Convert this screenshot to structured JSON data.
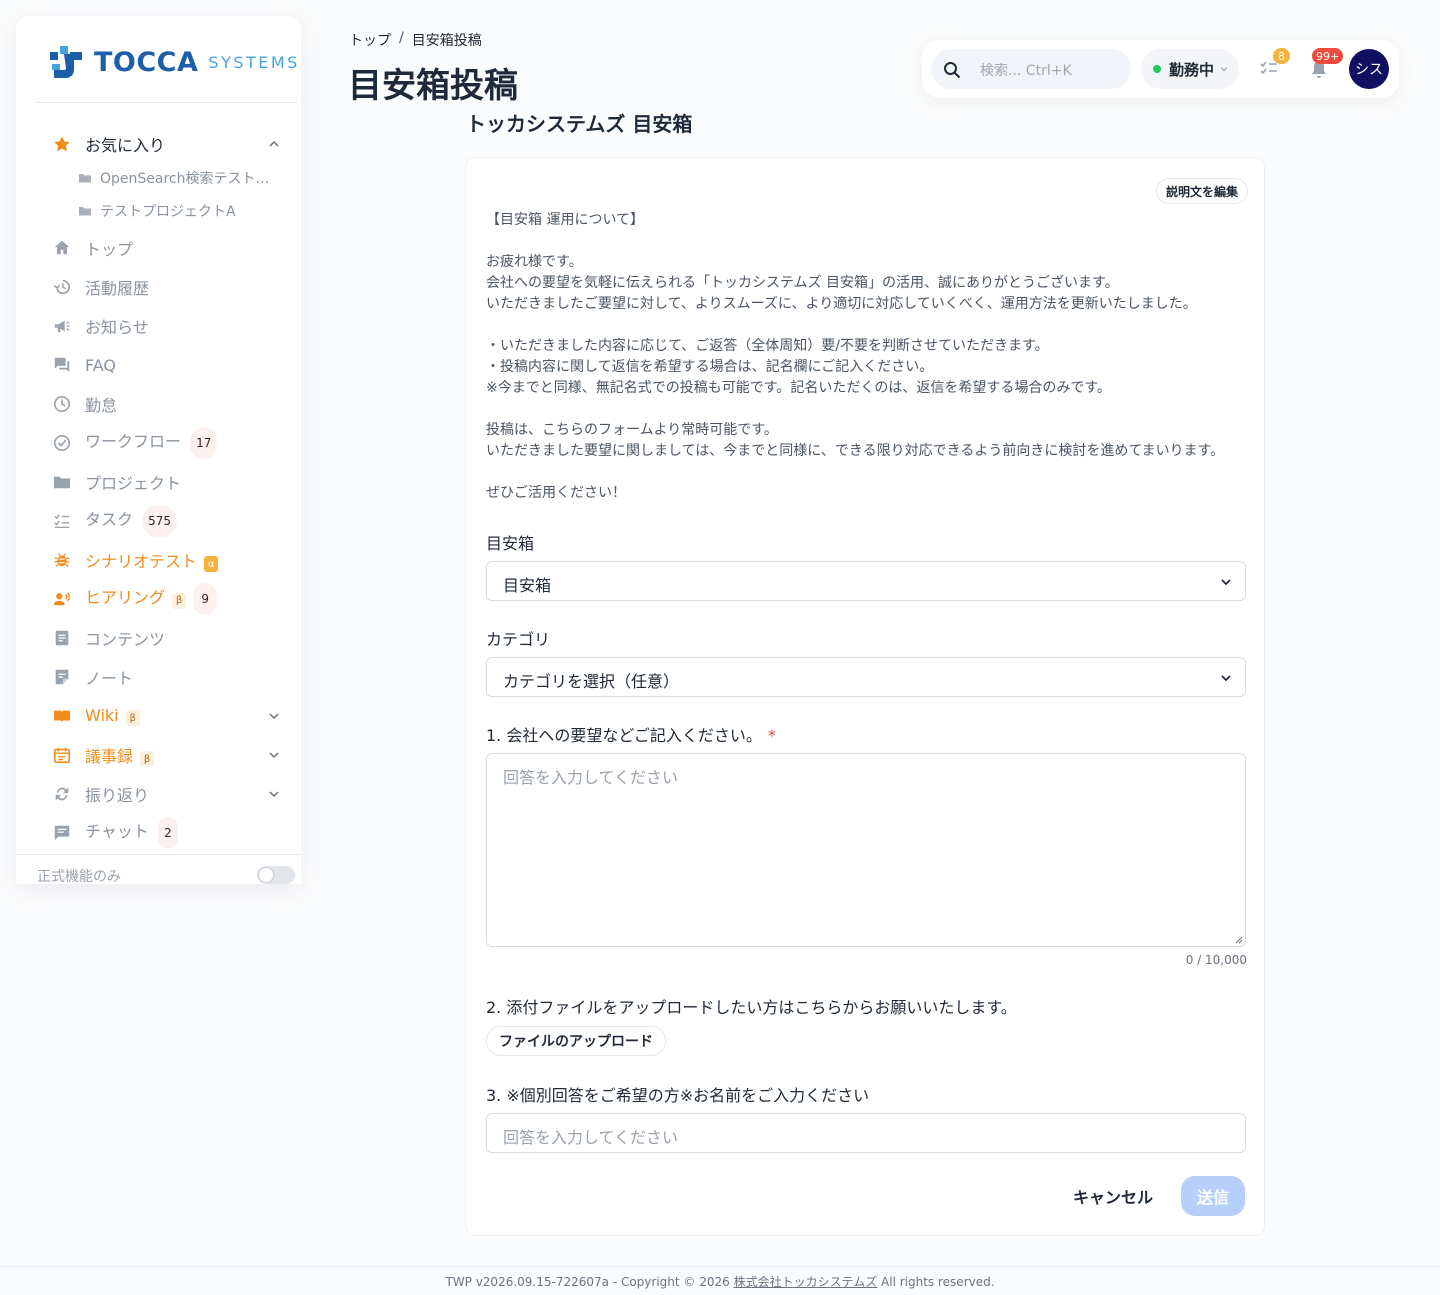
{
  "brand": {
    "name": "TOCCA",
    "suffix": "SYSTEMS",
    "colors": {
      "primary": "#1c5fa8",
      "light": "#4aa4dc"
    }
  },
  "sidebar": {
    "favorites": {
      "label": "お気に入り",
      "icon": "star-icon",
      "items": [
        {
          "label": "OpenSearch検索テスト用プ…",
          "icon": "folder-icon"
        },
        {
          "label": "テストプロジェクトA",
          "icon": "folder-icon"
        }
      ]
    },
    "items": [
      {
        "label": "トップ",
        "icon": "home-icon"
      },
      {
        "label": "活動履歴",
        "icon": "history-icon"
      },
      {
        "label": "お知らせ",
        "icon": "megaphone-icon"
      },
      {
        "label": "FAQ",
        "icon": "forum-icon"
      },
      {
        "label": "勤怠",
        "icon": "clock-icon"
      },
      {
        "label": "ワークフロー",
        "icon": "check-circle-icon",
        "count": "17"
      },
      {
        "label": "プロジェクト",
        "icon": "folder-icon"
      },
      {
        "label": "タスク",
        "icon": "checklist-icon",
        "count": "575"
      },
      {
        "label": "シナリオテスト",
        "icon": "bug-icon",
        "tag": "α"
      },
      {
        "label": "ヒアリング",
        "icon": "speaker-person-icon",
        "tag": "β",
        "count": "9"
      },
      {
        "label": "コンテンツ",
        "icon": "document-icon"
      },
      {
        "label": "ノート",
        "icon": "note-icon"
      },
      {
        "label": "Wiki",
        "icon": "book-icon",
        "tag": "β"
      },
      {
        "label": "議事録",
        "icon": "calendar-icon",
        "tag": "β"
      },
      {
        "label": "振り返り",
        "icon": "refresh-icon"
      },
      {
        "label": "チャット",
        "icon": "chat-icon",
        "count": "2"
      }
    ],
    "footer_label": "正式機能のみ"
  },
  "header": {
    "breadcrumb": [
      "トップ",
      "目安箱投稿"
    ],
    "breadcrumb_sep": "/",
    "title": "目安箱投稿",
    "search_placeholder": "検索... Ctrl+K",
    "status_label": "勤務中",
    "tasks_badge": "8",
    "notifications_badge": "99+",
    "avatar_initials": "シス"
  },
  "main": {
    "box_title": "トッカシステムズ 目安箱",
    "edit_description_label": "説明文を編集",
    "description": [
      "【目安箱 運用について】",
      "",
      "お疲れ様です。",
      "会社への要望を気軽に伝えられる「トッカシステムズ 目安箱」の活用、誠にありがとうございます。",
      "いただきましたご要望に対して、よりスムーズに、より適切に対応していくべく、運用方法を更新いたしました。",
      "",
      "・いただきました内容に応じて、ご返答（全体周知）要/不要を判断させていただきます。",
      "・投稿内容に関して返信を希望する場合は、記名欄にご記入ください。",
      "※今までと同様、無記名式での投稿も可能です。記名いただくのは、返信を希望する場合のみです。",
      "",
      "投稿は、こちらのフォームより常時可能です。",
      "いただきました要望に関しましては、今までと同様に、できる限り対応できるよう前向きに検討を進めてまいります。",
      "",
      "ぜひご活用ください！"
    ],
    "form": {
      "box_label": "目安箱",
      "box_value": "目安箱",
      "category_label": "カテゴリ",
      "category_value": "カテゴリを選択（任意）",
      "q1_label": "1. 会社への要望などご記入ください。",
      "q1_required": "*",
      "q1_placeholder": "回答を入力してください",
      "q1_counter": "0 / 10,000",
      "q2_label": "2. 添付ファイルをアップロードしたい方はこちらからお願いいたします。",
      "q2_button": "ファイルのアップロード",
      "q3_label": "3. ※個別回答をご希望の方※お名前をご入力ください",
      "q3_placeholder": "回答を入力してください",
      "cancel_label": "キャンセル",
      "submit_label": "送信"
    }
  },
  "footer": {
    "prefix": "TWP v2026.09.15-722607a - Copyright © 2026 ",
    "company": "株式会社トッカシステムズ",
    "suffix": " All rights reserved."
  }
}
